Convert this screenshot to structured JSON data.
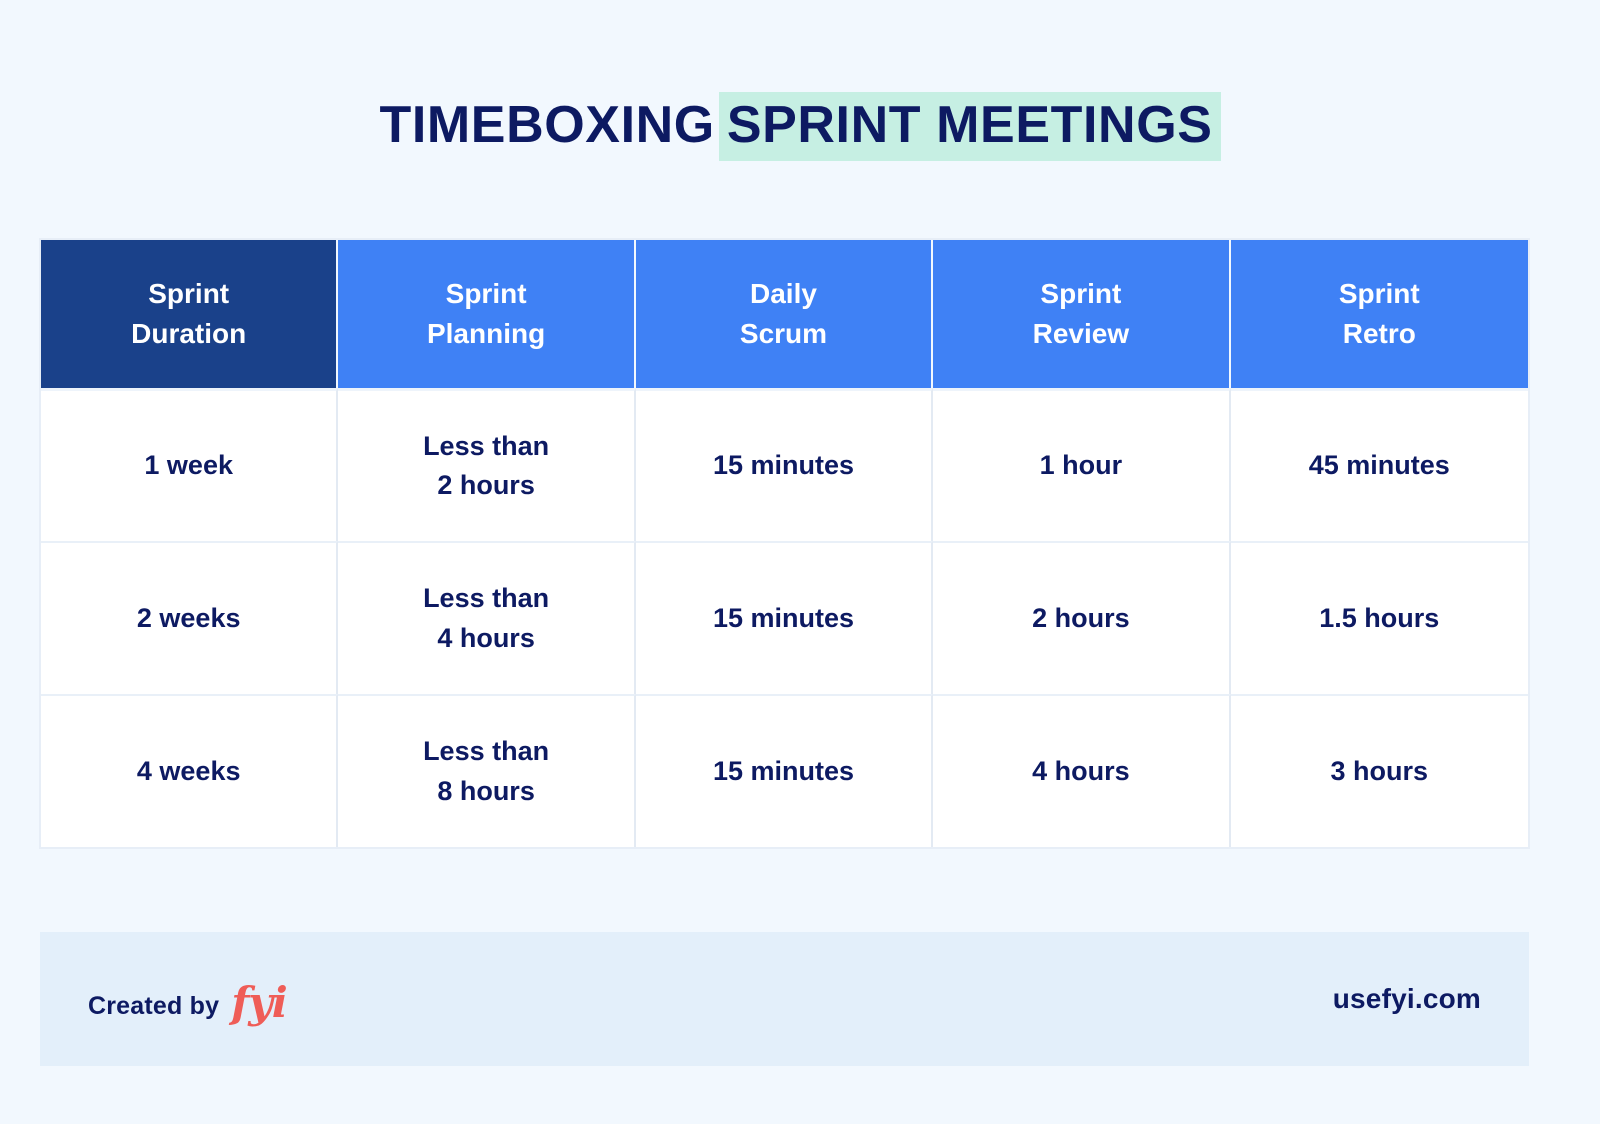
{
  "title": {
    "plain_part": "TIMEBOXING",
    "highlighted_part": "SPRINT MEETINGS",
    "highlight_color": "#c6efe3",
    "text_color": "#0d1a62"
  },
  "colors": {
    "page_background": "#f2f8fe",
    "header_first_column": "#1a418a",
    "header_other_columns": "#3f81f5",
    "cell_background": "#ffffff",
    "cell_text": "#0d1a62",
    "footer_background": "#e3effa",
    "brand_coral": "#ef5d57"
  },
  "table": {
    "headers": [
      "Sprint\nDuration",
      "Sprint\nPlanning",
      "Daily\nScrum",
      "Sprint\nReview",
      "Sprint\nRetro"
    ],
    "headers_lines": [
      [
        "Sprint",
        "Duration"
      ],
      [
        "Sprint",
        "Planning"
      ],
      [
        "Daily",
        "Scrum"
      ],
      [
        "Sprint",
        "Review"
      ],
      [
        "Sprint",
        "Retro"
      ]
    ],
    "rows": [
      {
        "sprint_duration": "1 week",
        "sprint_planning": "Less than\n2 hours",
        "sprint_planning_lines": [
          "Less than",
          "2 hours"
        ],
        "daily_scrum": "15 minutes",
        "sprint_review": "1 hour",
        "sprint_retro": "45 minutes"
      },
      {
        "sprint_duration": "2 weeks",
        "sprint_planning": "Less than\n4 hours",
        "sprint_planning_lines": [
          "Less than",
          "4 hours"
        ],
        "daily_scrum": "15 minutes",
        "sprint_review": "2 hours",
        "sprint_retro": "1.5 hours"
      },
      {
        "sprint_duration": "4 weeks",
        "sprint_planning": "Less than\n8 hours",
        "sprint_planning_lines": [
          "Less than",
          "8 hours"
        ],
        "daily_scrum": "15 minutes",
        "sprint_review": "4 hours",
        "sprint_retro": "3 hours"
      }
    ]
  },
  "chart_data": {
    "type": "table",
    "title": "TIMEBOXING SPRINT MEETINGS",
    "columns": [
      "Sprint Duration",
      "Sprint Planning",
      "Daily Scrum",
      "Sprint Review",
      "Sprint Retro"
    ],
    "rows": [
      [
        "1 week",
        "Less than 2 hours",
        "15 minutes",
        "1 hour",
        "45 minutes"
      ],
      [
        "2 weeks",
        "Less than 4 hours",
        "15 minutes",
        "2 hours",
        "1.5 hours"
      ],
      [
        "4 weeks",
        "Less than 8 hours",
        "15 minutes",
        "4 hours",
        "3 hours"
      ]
    ]
  },
  "footer": {
    "created_by_label": "Created by",
    "brand_logo_text": "fyi",
    "site_url": "usefyi.com"
  }
}
